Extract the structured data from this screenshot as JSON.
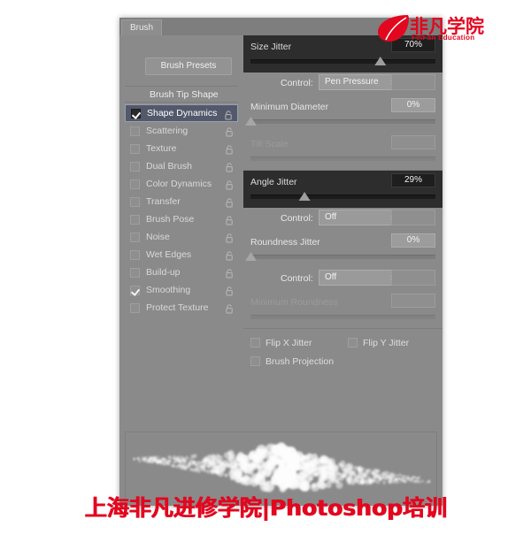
{
  "panel": {
    "tab_label": "Brush",
    "window_controls": [
      {
        "name": "collapse-button",
        "glyph": "◄◄"
      },
      {
        "name": "close-button",
        "glyph": "✕"
      }
    ],
    "presets_button": "Brush Presets",
    "brush_tip_shape": "Brush Tip Shape"
  },
  "dynamics_list": [
    {
      "label": "Shape Dynamics",
      "checked": true,
      "selected": true
    },
    {
      "label": "Scattering",
      "checked": false,
      "selected": false
    },
    {
      "label": "Texture",
      "checked": false,
      "selected": false
    },
    {
      "label": "Dual Brush",
      "checked": false,
      "selected": false
    },
    {
      "label": "Color Dynamics",
      "checked": false,
      "selected": false
    },
    {
      "label": "Transfer",
      "checked": false,
      "selected": false
    },
    {
      "label": "Brush Pose",
      "checked": false,
      "selected": false
    },
    {
      "label": "Noise",
      "checked": false,
      "selected": false
    },
    {
      "label": "Wet Edges",
      "checked": false,
      "selected": false
    },
    {
      "label": "Build-up",
      "checked": false,
      "selected": false
    },
    {
      "label": "Smoothing",
      "checked": true,
      "selected": false
    },
    {
      "label": "Protect Texture",
      "checked": false,
      "selected": false
    }
  ],
  "controls": {
    "size_jitter": {
      "label": "Size Jitter",
      "value": "70%",
      "percent": 70,
      "highlighted": true
    },
    "size_control": {
      "label": "Control:",
      "value": "Pen Pressure"
    },
    "minimum_diameter": {
      "label": "Minimum Diameter",
      "value": "0%",
      "percent": 0
    },
    "tilt_scale": {
      "label": "Tilt Scale",
      "value": "",
      "percent": 0,
      "disabled": true
    },
    "angle_jitter": {
      "label": "Angle Jitter",
      "value": "29%",
      "percent": 29,
      "highlighted": true
    },
    "angle_control": {
      "label": "Control:",
      "value": "Off"
    },
    "roundness_jitter": {
      "label": "Roundness Jitter",
      "value": "0%",
      "percent": 0
    },
    "roundness_control": {
      "label": "Control:",
      "value": "Off"
    },
    "minimum_roundness": {
      "label": "Minimum Roundness",
      "value": "",
      "percent": 0,
      "disabled": true
    },
    "flip_x_jitter": {
      "label": "Flip X Jitter",
      "checked": false
    },
    "flip_y_jitter": {
      "label": "Flip Y Jitter",
      "checked": false
    },
    "brush_projection": {
      "label": "Brush Projection",
      "checked": false
    }
  },
  "logo": {
    "chinese": "非凡学院",
    "english": "FeiFan Education",
    "color": "#e2071f"
  },
  "watermark": {
    "text": "上海非凡进修学院|Photoshop培训",
    "color": "#e2071f"
  },
  "colors": {
    "panel_bg": "#8a8a8a",
    "dark_section": "#2d2d2d",
    "selected_row": "#53586b",
    "accent_red": "#e2071f"
  }
}
